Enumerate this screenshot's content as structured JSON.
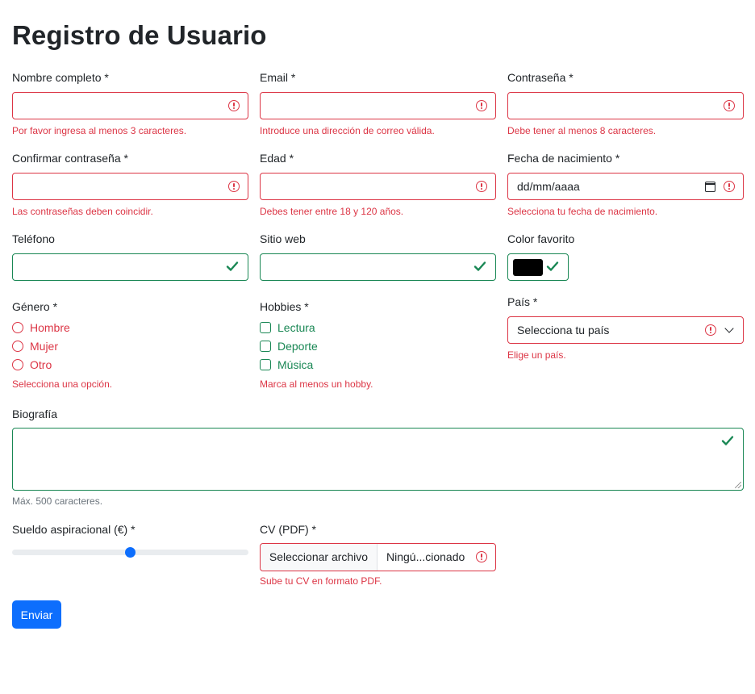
{
  "title": "Registro de Usuario",
  "fields": {
    "nombre": {
      "label": "Nombre completo *",
      "error": "Por favor ingresa al menos 3 caracteres."
    },
    "email": {
      "label": "Email *",
      "error": "Introduce una dirección de correo válida."
    },
    "password": {
      "label": "Contraseña *",
      "error": "Debe tener al menos 8 caracteres."
    },
    "confirm": {
      "label": "Confirmar contraseña *",
      "error": "Las contraseñas deben coincidir."
    },
    "edad": {
      "label": "Edad *",
      "error": "Debes tener entre 18 y 120 años."
    },
    "fecha": {
      "label": "Fecha de nacimiento *",
      "placeholder": "dd/mm/aaaa",
      "error": "Selecciona tu fecha de nacimiento."
    },
    "telefono": {
      "label": "Teléfono"
    },
    "web": {
      "label": "Sitio web"
    },
    "color": {
      "label": "Color favorito",
      "value": "#000000"
    },
    "genero": {
      "label": "Género *",
      "options": [
        "Hombre",
        "Mujer",
        "Otro"
      ],
      "error": "Selecciona una opción."
    },
    "hobbies": {
      "label": "Hobbies *",
      "options": [
        "Lectura",
        "Deporte",
        "Música"
      ],
      "error": "Marca al menos un hobby."
    },
    "pais": {
      "label": "País *",
      "value": "Selecciona tu país",
      "error": "Elige un país."
    },
    "bio": {
      "label": "Biografía",
      "hint": "Máx. 500 caracteres."
    },
    "sueldo": {
      "label": "Sueldo aspiracional (€) *",
      "level": 0.5
    },
    "cv": {
      "label": "CV (PDF) *",
      "button": "Seleccionar archivo",
      "filename": "Ningú...cionado",
      "error": "Sube tu CV en formato PDF."
    }
  },
  "submit": "Enviar",
  "colors": {
    "error": "#dc3545",
    "valid": "#198754",
    "primary": "#0d6efd"
  }
}
